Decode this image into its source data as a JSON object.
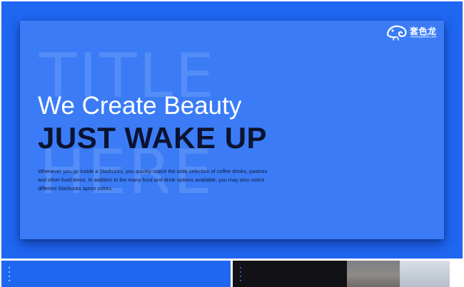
{
  "slide": {
    "ghost_line_1": "TITLE",
    "ghost_line_2": "HERE",
    "headline": "We Create Beauty",
    "subheadline": "JUST WAKE UP",
    "body": "Whenever you go inside a Starbucks, you quickly notice the wide selection of coffee drinks, pastries and other food items. In addition to the many food and drink options available, you may also notice different Starbucks apron colors."
  },
  "logo": {
    "name": "套色龙",
    "url": "www.pptfob.com"
  },
  "colors": {
    "stage": "#1f66f0",
    "card": "#3b7cf6",
    "headline": "#ffffff",
    "subheadline": "#0b1330"
  },
  "thumbnails": [
    {
      "icon": "dots-indicator"
    },
    {
      "icon": "dots-indicator"
    }
  ]
}
